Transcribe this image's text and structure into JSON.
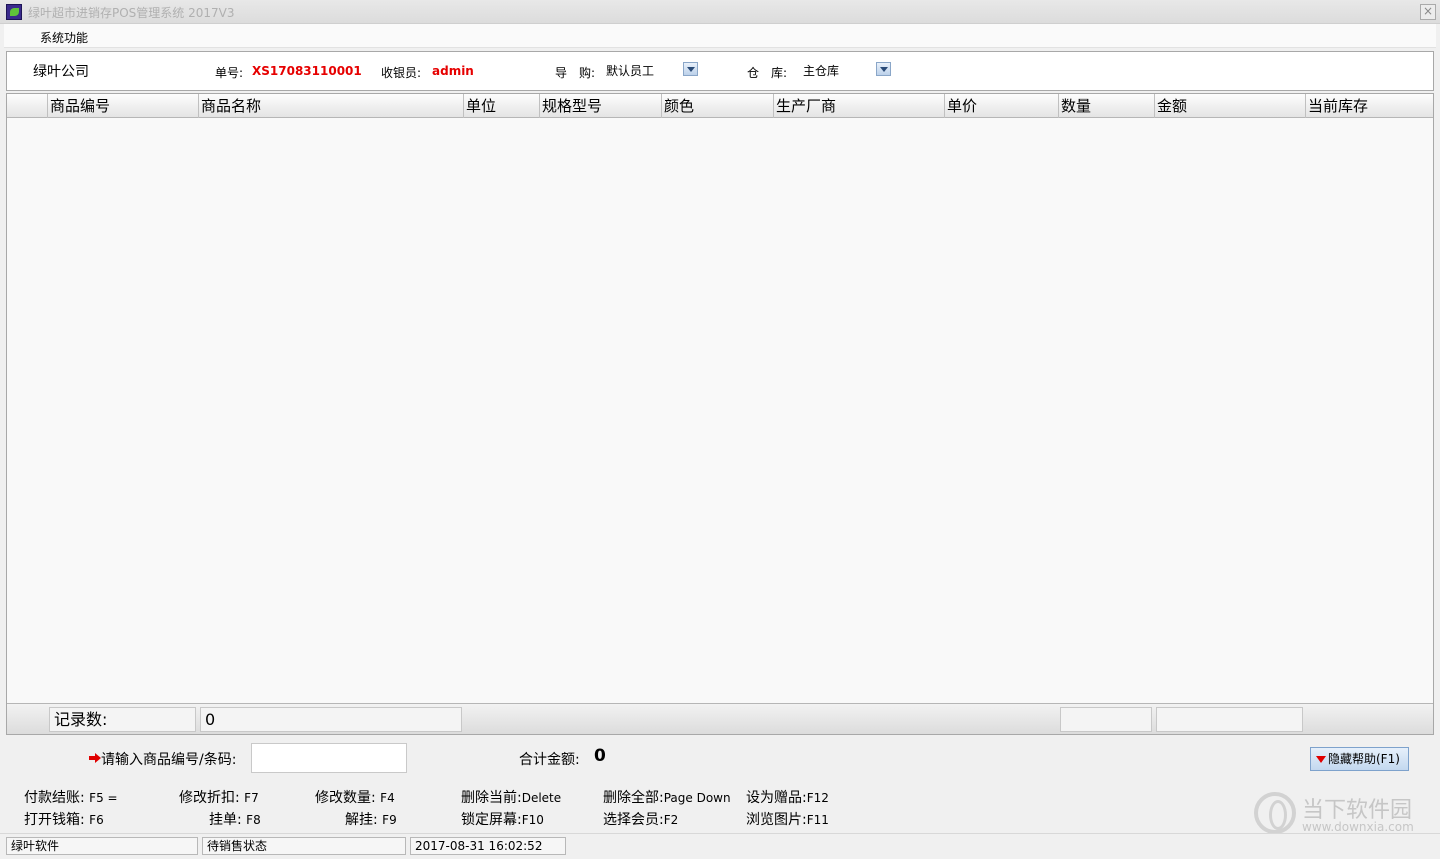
{
  "window": {
    "title": "绿叶超市进销存POS管理系统 2017V3",
    "close_glyph": "×"
  },
  "menu": {
    "items": [
      "系统功能"
    ]
  },
  "info": {
    "company": "绿叶公司",
    "order_label": "单号:",
    "order_no": "XS17083110001",
    "cashier_label": "收银员:",
    "cashier": "admin",
    "guide_label": "导　购:",
    "guide_value": "默认员工",
    "warehouse_label": "仓　库:",
    "warehouse_value": "主仓库"
  },
  "grid": {
    "columns": [
      "",
      "商品编号",
      "商品名称",
      "单位",
      "规格型号",
      "颜色",
      "生产厂商",
      "单价",
      "数量",
      "金额",
      "当前库存"
    ],
    "rows": [],
    "footer": {
      "record_label": "记录数:",
      "record_count": "0",
      "qty_total": "",
      "amount_total": ""
    }
  },
  "entry": {
    "prompt": "请输入商品编号/条码:",
    "value": "",
    "total_label": "合计金额:",
    "total_value": "0",
    "help_button": "隐藏帮助(F1)"
  },
  "hotkeys": [
    {
      "label": "付款结账:",
      "key": "F5 ="
    },
    {
      "label": "修改折扣:",
      "key": "F7"
    },
    {
      "label": "修改数量:",
      "key": "F4"
    },
    {
      "label": "删除当前:",
      "key": "Delete"
    },
    {
      "label": "删除全部:",
      "key": "Page Down"
    },
    {
      "label": "设为赠品:",
      "key": "F12"
    },
    {
      "label": "打开钱箱:",
      "key": "F6"
    },
    {
      "label": "挂单:",
      "key": "F8"
    },
    {
      "label": "解挂:",
      "key": "F9"
    },
    {
      "label": "锁定屏幕:",
      "key": "F10"
    },
    {
      "label": "选择会员:",
      "key": "F2"
    },
    {
      "label": "浏览图片:",
      "key": "F11"
    }
  ],
  "status": {
    "vendor": "绿叶软件",
    "state": "待销售状态",
    "datetime": "2017-08-31 16:02:52"
  },
  "watermark": {
    "name": "当下软件园",
    "url": "www.downxia.com",
    "logo_icon": "downxia-logo-icon"
  },
  "colors": {
    "accent_red": "#e60000",
    "help_button_bg": "#c3d8ef"
  }
}
